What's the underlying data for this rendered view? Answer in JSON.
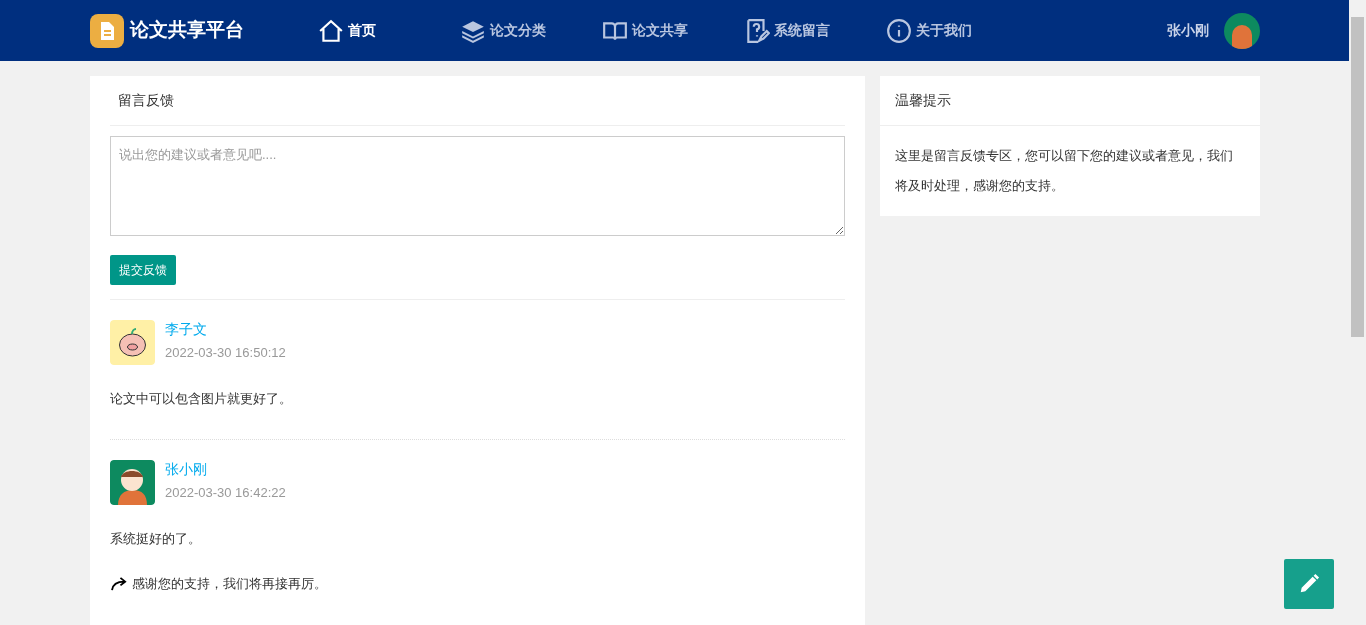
{
  "header": {
    "logo": "论文共享平台",
    "nav": [
      {
        "label": "首页",
        "kind": "home",
        "selected": true
      },
      {
        "label": "论文分类",
        "kind": "layers",
        "selected": false
      },
      {
        "label": "论文共享",
        "kind": "book",
        "selected": false
      },
      {
        "label": "系统留言",
        "kind": "message",
        "selected": false
      },
      {
        "label": "关于我们",
        "kind": "info",
        "selected": false
      }
    ],
    "user": "张小刚"
  },
  "feedback": {
    "title": "留言反馈",
    "placeholder": "说出您的建议或者意见吧....",
    "submit": "提交反馈",
    "messages": [
      {
        "author": "李子文",
        "kind": "pig",
        "time": "2022-03-30 16:50:12",
        "content": "论文中可以包含图片就更好了。"
      },
      {
        "author": "张小刚",
        "kind": "girl",
        "time": "2022-03-30 16:42:22",
        "content": "系统挺好的了。",
        "reply": "感谢您的支持，我们将再接再厉。"
      }
    ]
  },
  "tips": {
    "title": "温馨提示",
    "text": "这里是留言反馈专区，您可以留下您的建议或者意见，我们将及时处理，感谢您的支持。"
  }
}
